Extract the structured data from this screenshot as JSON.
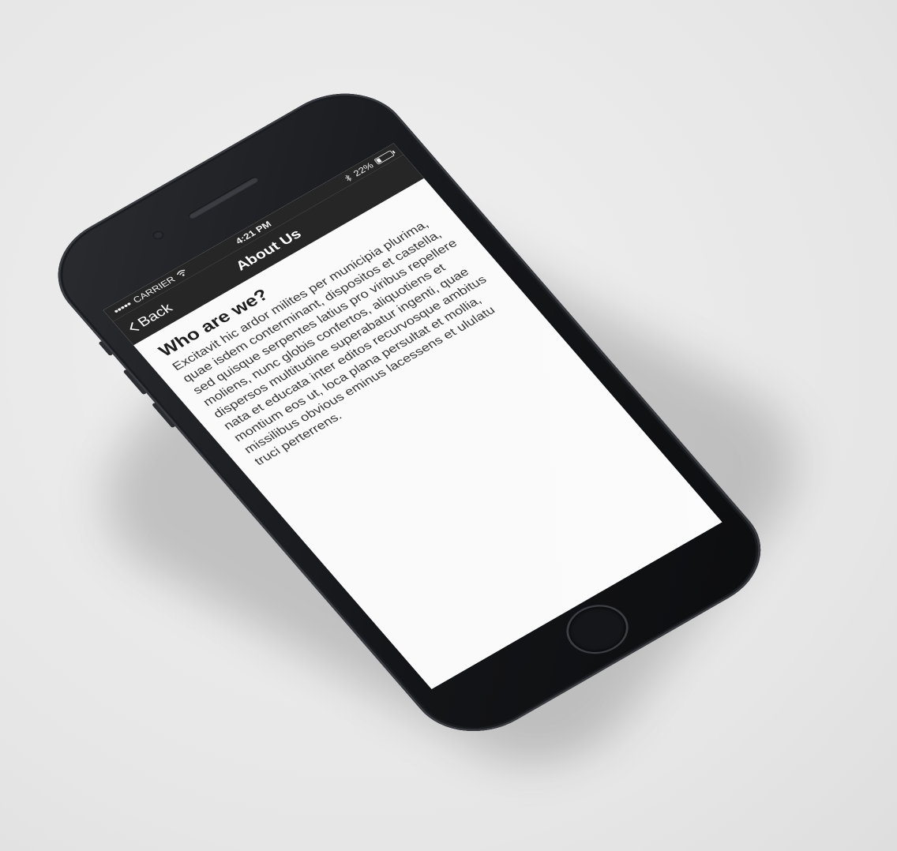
{
  "status_bar": {
    "signal": "●●●●●",
    "carrier": "CARRIER",
    "wifi_icon": "wifi-icon",
    "time": "4:21 PM",
    "bluetooth_icon": "bluetooth-icon",
    "battery_percent": "22%",
    "battery_level": 0.22
  },
  "nav_bar": {
    "back_label": "Back",
    "title": "About Us"
  },
  "content": {
    "heading": "Who are we?",
    "paragraph": "Excitavit hic ardor milites per municipia plurima, quae isdem conterminant, dispositos et castella, sed quisque serpentes latius pro viribus repellere moliens, nunc globis confertos, aliquotiens et dispersos multitudine superabatur ingenti, quae nata et educata inter editos recurvosque ambitus montium eos ut, loca plana persultat et mollia, missilibus obvious eminus lacessens et ululatu truci perterrens."
  }
}
